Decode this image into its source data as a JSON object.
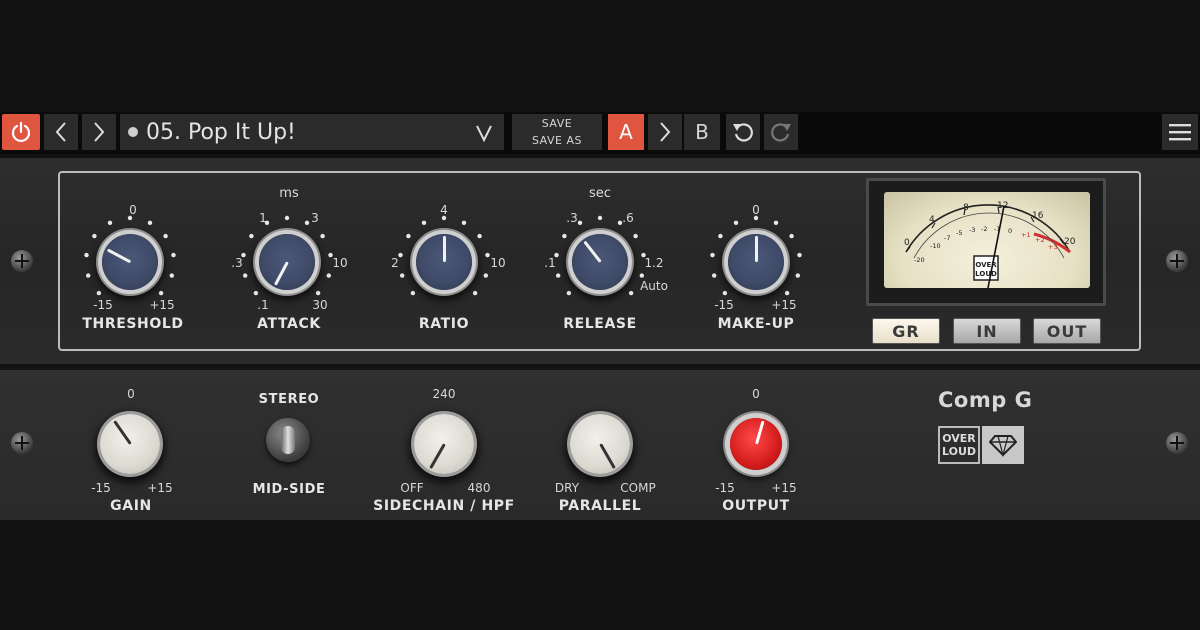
{
  "toolbar": {
    "preset_name": "05. Pop It Up!",
    "save_label": "SAVE",
    "save_as_label": "SAVE AS",
    "a_label": "A",
    "b_label": "B",
    "accent_color": "#e0553f"
  },
  "compressor": {
    "threshold": {
      "label": "THRESHOLD",
      "scale_top": "0",
      "scale_min": "-15",
      "scale_max": "+15"
    },
    "attack": {
      "label": "ATTACK",
      "unit": "ms",
      "ticks": [
        ".1",
        ".3",
        "1",
        "3",
        "10",
        "30"
      ]
    },
    "ratio": {
      "label": "RATIO",
      "ticks": [
        "2",
        "4",
        "10"
      ]
    },
    "release": {
      "label": "RELEASE",
      "unit": "sec",
      "ticks": [
        ".1",
        ".3",
        ".6",
        "1.2",
        "Auto"
      ]
    },
    "makeup": {
      "label": "MAKE-UP",
      "scale_top": "0",
      "scale_min": "-15",
      "scale_max": "+15"
    }
  },
  "meter": {
    "top_scale": [
      "0",
      "4",
      "8",
      "12",
      "16",
      "20"
    ],
    "inner_scale": [
      "-20",
      "-10",
      "-7",
      "-5",
      "-3",
      "-2",
      "-1",
      "0",
      "+1",
      "+2",
      "+3"
    ],
    "brand_line1": "OVER",
    "brand_line2": "LOUD",
    "buttons": {
      "gr": "GR",
      "in": "IN",
      "out": "OUT"
    },
    "selected_mode": "GR"
  },
  "bottom": {
    "gain": {
      "label": "GAIN",
      "scale_top": "0",
      "scale_min": "-15",
      "scale_max": "+15"
    },
    "stereo_mode": {
      "top_label": "STEREO",
      "bottom_label": "MID-SIDE"
    },
    "sidechain": {
      "label": "SIDECHAIN / HPF",
      "scale_top": "240",
      "scale_min": "OFF",
      "scale_max": "480"
    },
    "parallel": {
      "label": "PARALLEL",
      "scale_min": "DRY",
      "scale_max": "COMP"
    },
    "output": {
      "label": "OUTPUT",
      "scale_top": "0",
      "scale_min": "-15",
      "scale_max": "+15"
    }
  },
  "branding": {
    "product_name": "Comp G",
    "logo_line1": "OVER",
    "logo_line2": "LOUD"
  }
}
